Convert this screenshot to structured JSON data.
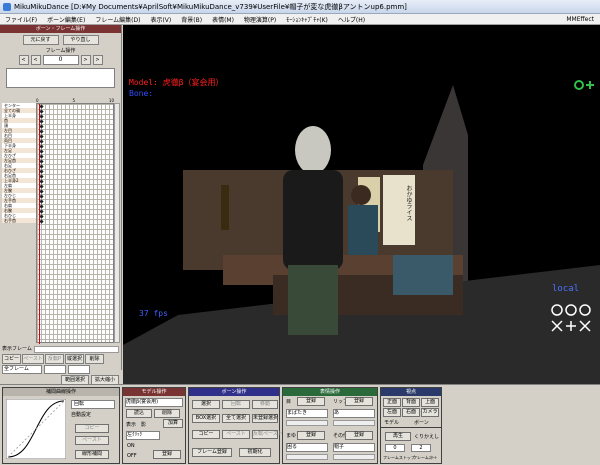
{
  "window": {
    "title": "MikuMikuDance [D:¥My Documents¥AprilSoft¥MikuMikuDance_v739¥UserFile¥帽子が変な虎徹βアントンup6.pmm]"
  },
  "menu": [
    "ファイル(F)",
    "ボーン編集(E)",
    "フレーム編集(D)",
    "表示(V)",
    "背景(B)",
    "表情(M)",
    "物理演算(P)",
    "ﾓｰｼｮﾝｷｬﾌﾟﾁｬ(K)",
    "ヘルプ(H)"
  ],
  "mmeffect": "MMEffect",
  "left": {
    "header": "ボーン・フレーム操作",
    "undo": "元に戻す",
    "redo": "やり直し",
    "frame_label": "フレーム操作",
    "frame_value": "0",
    "ruler": [
      "0",
      "5",
      "10"
    ],
    "bones": [
      "センター",
      "全ての親",
      "上半身",
      "首",
      "頭",
      "左目",
      "右目",
      "両目",
      "下半身",
      "左足",
      "左ひざ",
      "左足首",
      "右足",
      "右ひざ",
      "右足首",
      "上半身2",
      "左肩",
      "左腕",
      "左ひじ",
      "左手首",
      "右肩",
      "右腕",
      "右ひじ",
      "右手首"
    ],
    "view_frame": "表示フレーム",
    "copy": "コピー",
    "paste": "ペースト",
    "reverse": "反転P",
    "vertical": "縦選択",
    "delete": "削除",
    "all_frames": "全フレーム",
    "range_select": "範囲選択",
    "expand": "拡大縮小"
  },
  "viewport": {
    "model_line": "Model: 虎徹β（宴会用）",
    "bone_line": "Bone:",
    "fps": "37 fps",
    "local": "local",
    "sign_kanji": "おかゆライス"
  },
  "interp": {
    "header": "補間曲線操作",
    "rotate": "回転",
    "auto": "自動設定",
    "copy": "コピー",
    "paste": "ペースト",
    "linear": "線形補間"
  },
  "model": {
    "header": "モデル操作",
    "model_name": "虎徹β(宴会用)",
    "load": "読込",
    "delete": "削除",
    "show": "表示",
    "shadow": "影",
    "add_shadow": "加算",
    "sel": "左ｸﾘｯｸ",
    "on": "ON",
    "off": "OFF",
    "register": "登録"
  },
  "bone": {
    "header": "ボーン操作",
    "select": "選択",
    "rotate": "回転",
    "move": "移動",
    "box": "BOX選択",
    "all": "全て選択",
    "unreg": "未登録選択",
    "copy": "コピー",
    "paste": "ペースト",
    "reverse": "反転ペースト",
    "frame_reg": "フレーム登録",
    "init": "初期化"
  },
  "face": {
    "header": "表情操作",
    "eye": "目",
    "lip": "リップ",
    "brow": "まゆ",
    "other": "その他",
    "reg": "登録",
    "face1": "まばたき",
    "face2": "あ",
    "face3": "困る",
    "face4": "帽子"
  },
  "view": {
    "header": "視点",
    "front": "正面",
    "back": "背面",
    "top": "上面",
    "left": "左面",
    "right": "右面",
    "camera": "カメラ",
    "model_chk": "モデル",
    "bone_chk": "ボーン",
    "play": "再生",
    "loop": "くりかえし",
    "start": "0",
    "end": "2",
    "frame_stop": "フレームストップ",
    "frame_chk": "フレームｽﾀｰﾄ"
  }
}
